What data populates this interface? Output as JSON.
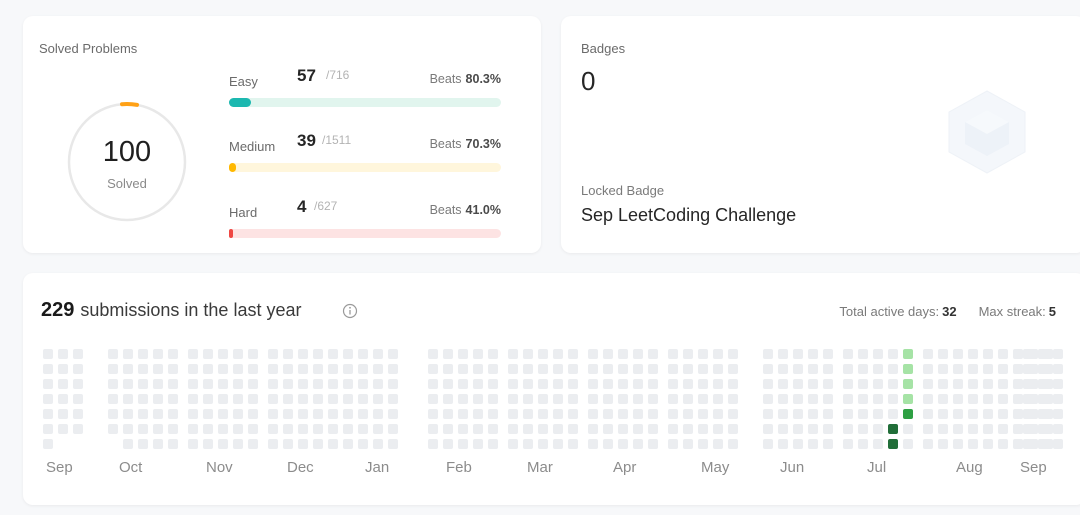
{
  "solved": {
    "title": "Solved Problems",
    "total": "100",
    "total_label": "Solved",
    "difficulties": [
      {
        "label": "Easy",
        "count": "57",
        "total": "/716",
        "beats_label": "Beats",
        "beats": "80.3%",
        "color": "#1cb8b0",
        "track": "#e1f5ee",
        "fraction": 0.08
      },
      {
        "label": "Medium",
        "count": "39",
        "total": "/1511",
        "beats_label": "Beats",
        "beats": "70.3%",
        "color": "#ffb800",
        "track": "#fff6dc",
        "fraction": 0.026
      },
      {
        "label": "Hard",
        "count": "4",
        "total": "/627",
        "beats_label": "Beats",
        "beats": "41.0%",
        "color": "#ef4743",
        "track": "#fde3e3",
        "fraction": 0.006
      }
    ]
  },
  "badges": {
    "title": "Badges",
    "count": "0",
    "locked_label": "Locked Badge",
    "locked_name": "Sep LeetCoding Challenge"
  },
  "submissions": {
    "count": "229",
    "label": "submissions in the last year",
    "active_days_label": "Total active days:",
    "active_days": "32",
    "max_streak_label": "Max streak:",
    "max_streak": "5",
    "months": [
      "Sep",
      "Oct",
      "Nov",
      "Dec",
      "Jan",
      "Feb",
      "Mar",
      "Apr",
      "May",
      "Jun",
      "Jul",
      "Aug",
      "Sep"
    ],
    "colors": {
      "empty": "#ebedf0",
      "level1": "#a6e3a6",
      "level2": "#40c463",
      "level3": "#2ea043",
      "level4": "#216e39"
    }
  }
}
